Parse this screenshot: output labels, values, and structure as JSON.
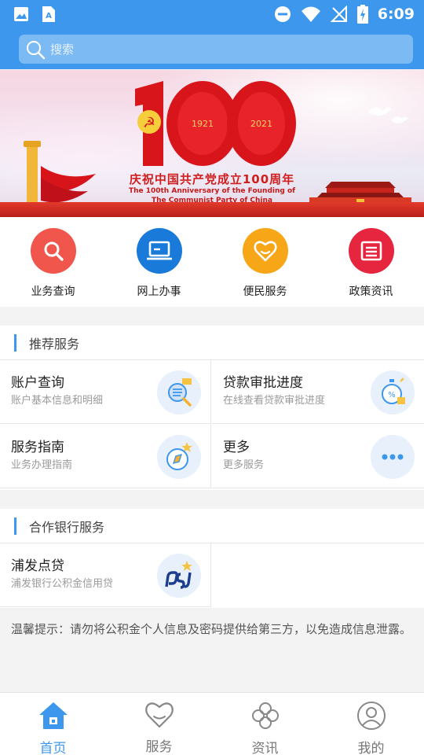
{
  "status_bar": {
    "time": "6:09"
  },
  "search": {
    "placeholder": "搜索"
  },
  "banner": {
    "number": "100",
    "year_left": "1921",
    "year_right": "2021",
    "title_cn": "庆祝中国共产党成立100周年",
    "title_en_1": "The 100th Anniversary of the Founding of",
    "title_en_2": "The Communist Party of China"
  },
  "quick_actions": [
    {
      "label": "业务查询",
      "icon": "search-icon",
      "color": "#f0564c"
    },
    {
      "label": "网上办事",
      "icon": "laptop-icon",
      "color": "#1a7ad9"
    },
    {
      "label": "便民服务",
      "icon": "heart-icon",
      "color": "#f6a617"
    },
    {
      "label": "政策资讯",
      "icon": "news-icon",
      "color": "#e5263e"
    }
  ],
  "recommended": {
    "title": "推荐服务",
    "items": [
      {
        "title": "账户查询",
        "subtitle": "账户基本信息和明细",
        "icon": "magnifier-doc-icon"
      },
      {
        "title": "贷款审批进度",
        "subtitle": "在线查看贷款审批进度",
        "icon": "stopwatch-icon"
      },
      {
        "title": "服务指南",
        "subtitle": "业务办理指南",
        "icon": "compass-icon"
      },
      {
        "title": "更多",
        "subtitle": "更多服务",
        "icon": "more-dots-icon"
      }
    ]
  },
  "partner_banks": {
    "title": "合作银行服务",
    "items": [
      {
        "title": "浦发点贷",
        "subtitle": "浦发银行公积金信用贷",
        "icon": "spdb-logo-icon"
      }
    ]
  },
  "notice": {
    "text": "温馨提示：请勿将公积金个人信息及密码提供给第三方，以免造成信息泄露。"
  },
  "tabbar": {
    "tabs": [
      {
        "label": "首页",
        "icon": "home-icon",
        "active": true
      },
      {
        "label": "服务",
        "icon": "heart-icon",
        "active": false
      },
      {
        "label": "资讯",
        "icon": "clover-icon",
        "active": false
      },
      {
        "label": "我的",
        "icon": "user-icon",
        "active": false
      }
    ]
  },
  "colors": {
    "primary": "#3d97ec",
    "banner_red": "#d11e1e"
  }
}
